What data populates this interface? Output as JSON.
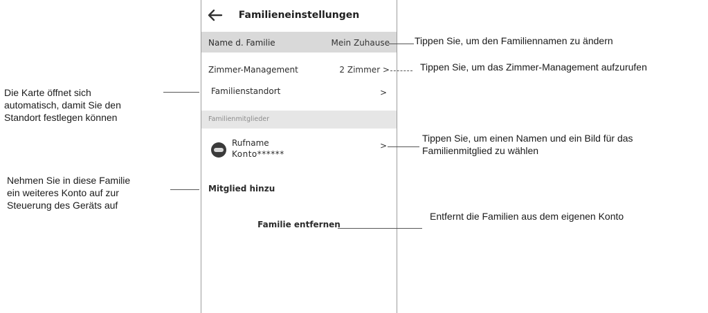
{
  "phone": {
    "header": {
      "title": "Familieneinstellungen",
      "back_icon": "back-arrow-icon"
    },
    "family_name": {
      "label": "Name d. Familie",
      "value": "Mein Zuhause"
    },
    "room_management": {
      "label": "Zimmer-Management",
      "value": "2 Zimmer >"
    },
    "family_location": {
      "label": "Familienstandort",
      "value": ">"
    },
    "members_section": {
      "title": "Familienmitglieder"
    },
    "member": {
      "name": "Rufname",
      "account": "Konto******",
      "arrow": ">"
    },
    "add_member": "Mitglied hinzu",
    "remove_family": "Familie entfernen"
  },
  "annotations": {
    "family_name": "Tippen Sie, um den Familiennamen zu ändern",
    "room_management": "Tippen Sie, um das Zimmer-Management aufzurufen",
    "location": [
      "Die Karte öffnet sich",
      "automatisch, damit Sie den",
      "Standort festlegen können"
    ],
    "member": [
      "Tippen Sie, um einen Namen und ein Bild für das",
      "Familienmitglied zu wählen"
    ],
    "add_member": [
      "Nehmen Sie in diese Familie",
      "ein weiteres Konto auf zur",
      "Steuerung des Geräts auf"
    ],
    "remove_family": "Entfernt die Familien aus dem eigenen Konto"
  }
}
